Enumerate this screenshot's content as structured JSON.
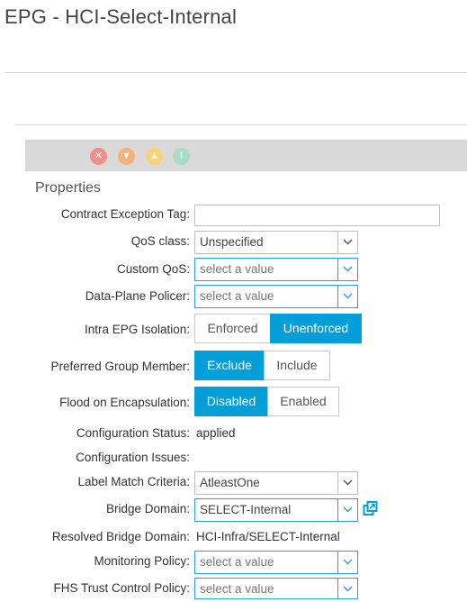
{
  "page": {
    "title": "EPG - HCI-Select-Internal"
  },
  "faults": [
    {
      "icon": "critical-fault-icon",
      "color": "#f28e8e",
      "glyph": "✕"
    },
    {
      "icon": "major-fault-icon",
      "color": "#f6b07c",
      "glyph": "▼"
    },
    {
      "icon": "minor-fault-icon",
      "color": "#f7d27a",
      "glyph": "▲"
    },
    {
      "icon": "warning-fault-icon",
      "color": "#a9dcc6",
      "glyph": "!"
    }
  ],
  "properties": {
    "section_title": "Properties",
    "contract_exception_tag": {
      "label": "Contract Exception Tag:",
      "value": ""
    },
    "qos_class": {
      "label": "QoS class:",
      "value": "Unspecified"
    },
    "custom_qos": {
      "label": "Custom QoS:",
      "placeholder": "select a value"
    },
    "data_plane_policer": {
      "label": "Data-Plane Policer:",
      "placeholder": "select a value"
    },
    "intra_epg_isolation": {
      "label": "Intra EPG Isolation:",
      "options": [
        "Enforced",
        "Unenforced"
      ],
      "selected": "Unenforced"
    },
    "preferred_group_member": {
      "label": "Preferred Group Member:",
      "options": [
        "Exclude",
        "Include"
      ],
      "selected": "Exclude"
    },
    "flood_on_encapsulation": {
      "label": "Flood on Encapsulation:",
      "options": [
        "Disabled",
        "Enabled"
      ],
      "selected": "Disabled"
    },
    "configuration_status": {
      "label": "Configuration Status:",
      "value": "applied"
    },
    "configuration_issues": {
      "label": "Configuration Issues:",
      "value": ""
    },
    "label_match_criteria": {
      "label": "Label Match Criteria:",
      "value": "AtleastOne"
    },
    "bridge_domain": {
      "label": "Bridge Domain:",
      "value": "SELECT-Internal"
    },
    "resolved_bridge_domain": {
      "label": "Resolved Bridge Domain:",
      "value": "HCI-Infra/SELECT-Internal"
    },
    "monitoring_policy": {
      "label": "Monitoring Policy:",
      "placeholder": "select a value"
    },
    "fhs_trust_control_policy": {
      "label": "FHS Trust Control Policy:",
      "placeholder": "select a value"
    }
  },
  "colors": {
    "accent": "#049fd9",
    "fault_bar": "#d9d9d9"
  }
}
